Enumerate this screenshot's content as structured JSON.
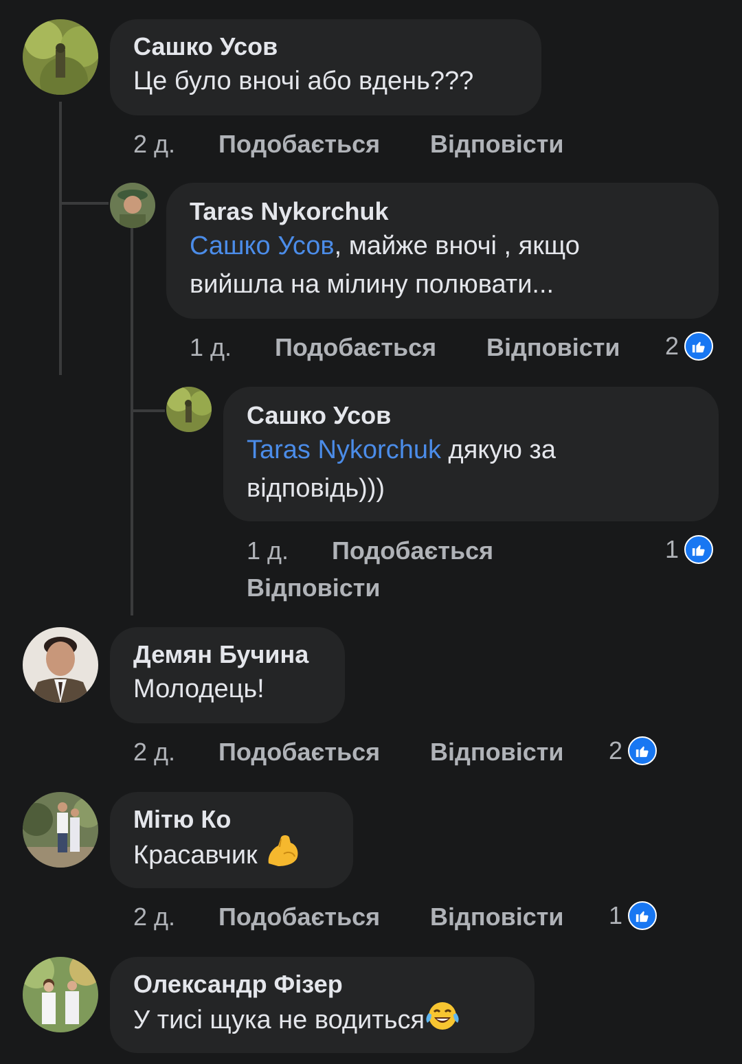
{
  "comments": [
    {
      "author": "Сашко Усов",
      "text": "Це було вночі або вдень???",
      "time": "2 д.",
      "like_label": "Подобається",
      "reply_label": "Відповісти"
    },
    {
      "author": "Taras Nykorchuk",
      "mention": "Сашко Усов",
      "text_line1": ", майже вночі , якщо",
      "text_line2": "вийшла на мілину полювати...",
      "time": "1 д.",
      "like_label": "Подобається",
      "reply_label": "Відповісти",
      "likes": "2"
    },
    {
      "author": "Сашко Усов",
      "mention": "Taras Nykorchuk",
      "text_line1": " дякую за",
      "text_line2": "відповідь)))",
      "time": "1 д.",
      "like_label": "Подобається",
      "reply_label": "Відповісти",
      "likes": "1"
    },
    {
      "author": "Демян Бучина",
      "text": "Молодець!",
      "time": "2 д.",
      "like_label": "Подобається",
      "reply_label": "Відповісти",
      "likes": "2"
    },
    {
      "author": "Мітю Ко",
      "text": "Красавчик ",
      "emoji": "flexed-biceps-emoji",
      "time": "2 д.",
      "like_label": "Подобається",
      "reply_label": "Відповісти",
      "likes": "1"
    },
    {
      "author": "Олександр Фізер",
      "text": "У тисі щука не водиться",
      "emoji": "tears-of-joy-emoji"
    }
  ],
  "colors": {
    "background": "#18191a",
    "bubble": "#242526",
    "mention": "#4b8ce8",
    "meta": "#b0b3b8",
    "like_blue": "#1877f2"
  }
}
